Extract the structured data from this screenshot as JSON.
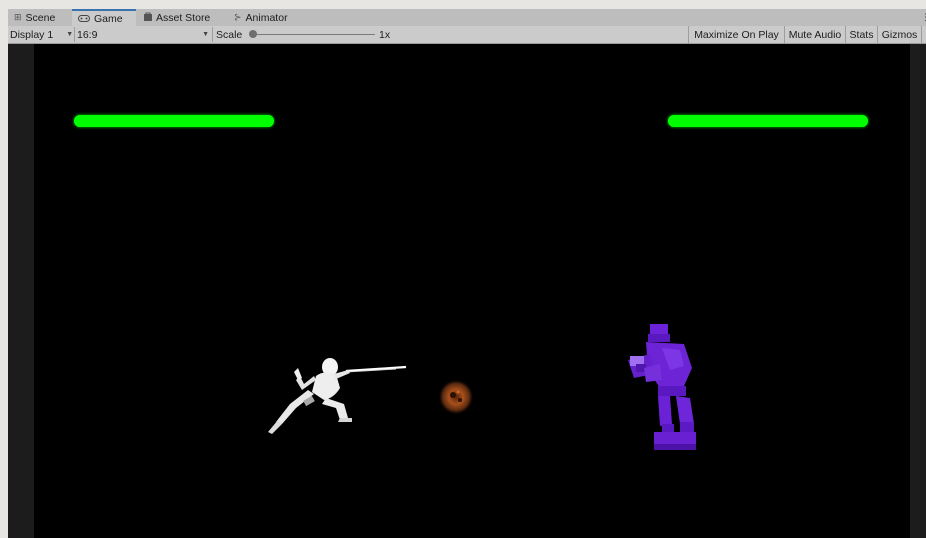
{
  "tabs": [
    {
      "label": "Scene",
      "icon": "grid-icon",
      "active": false
    },
    {
      "label": "Game",
      "icon": "gamepad-icon",
      "active": true
    },
    {
      "label": "Asset Store",
      "icon": "bag-icon",
      "active": false
    },
    {
      "label": "Animator",
      "icon": "animator-icon",
      "active": false
    }
  ],
  "toolbar": {
    "display": "Display 1",
    "aspect": "16:9",
    "scale_label": "Scale",
    "scale_value": "1x",
    "scale_fraction": 0.0,
    "maximize_on_play": "Maximize On Play",
    "mute_audio": "Mute Audio",
    "stats": "Stats",
    "gizmos": "Gizmos"
  },
  "game": {
    "player_health": 1.0,
    "enemy_health": 1.0,
    "colors": {
      "health": "#00ff00",
      "background": "#000000",
      "player": "#f2f2f2",
      "enemy": "#6a1fd0",
      "fireball": "#8a3a10"
    }
  }
}
